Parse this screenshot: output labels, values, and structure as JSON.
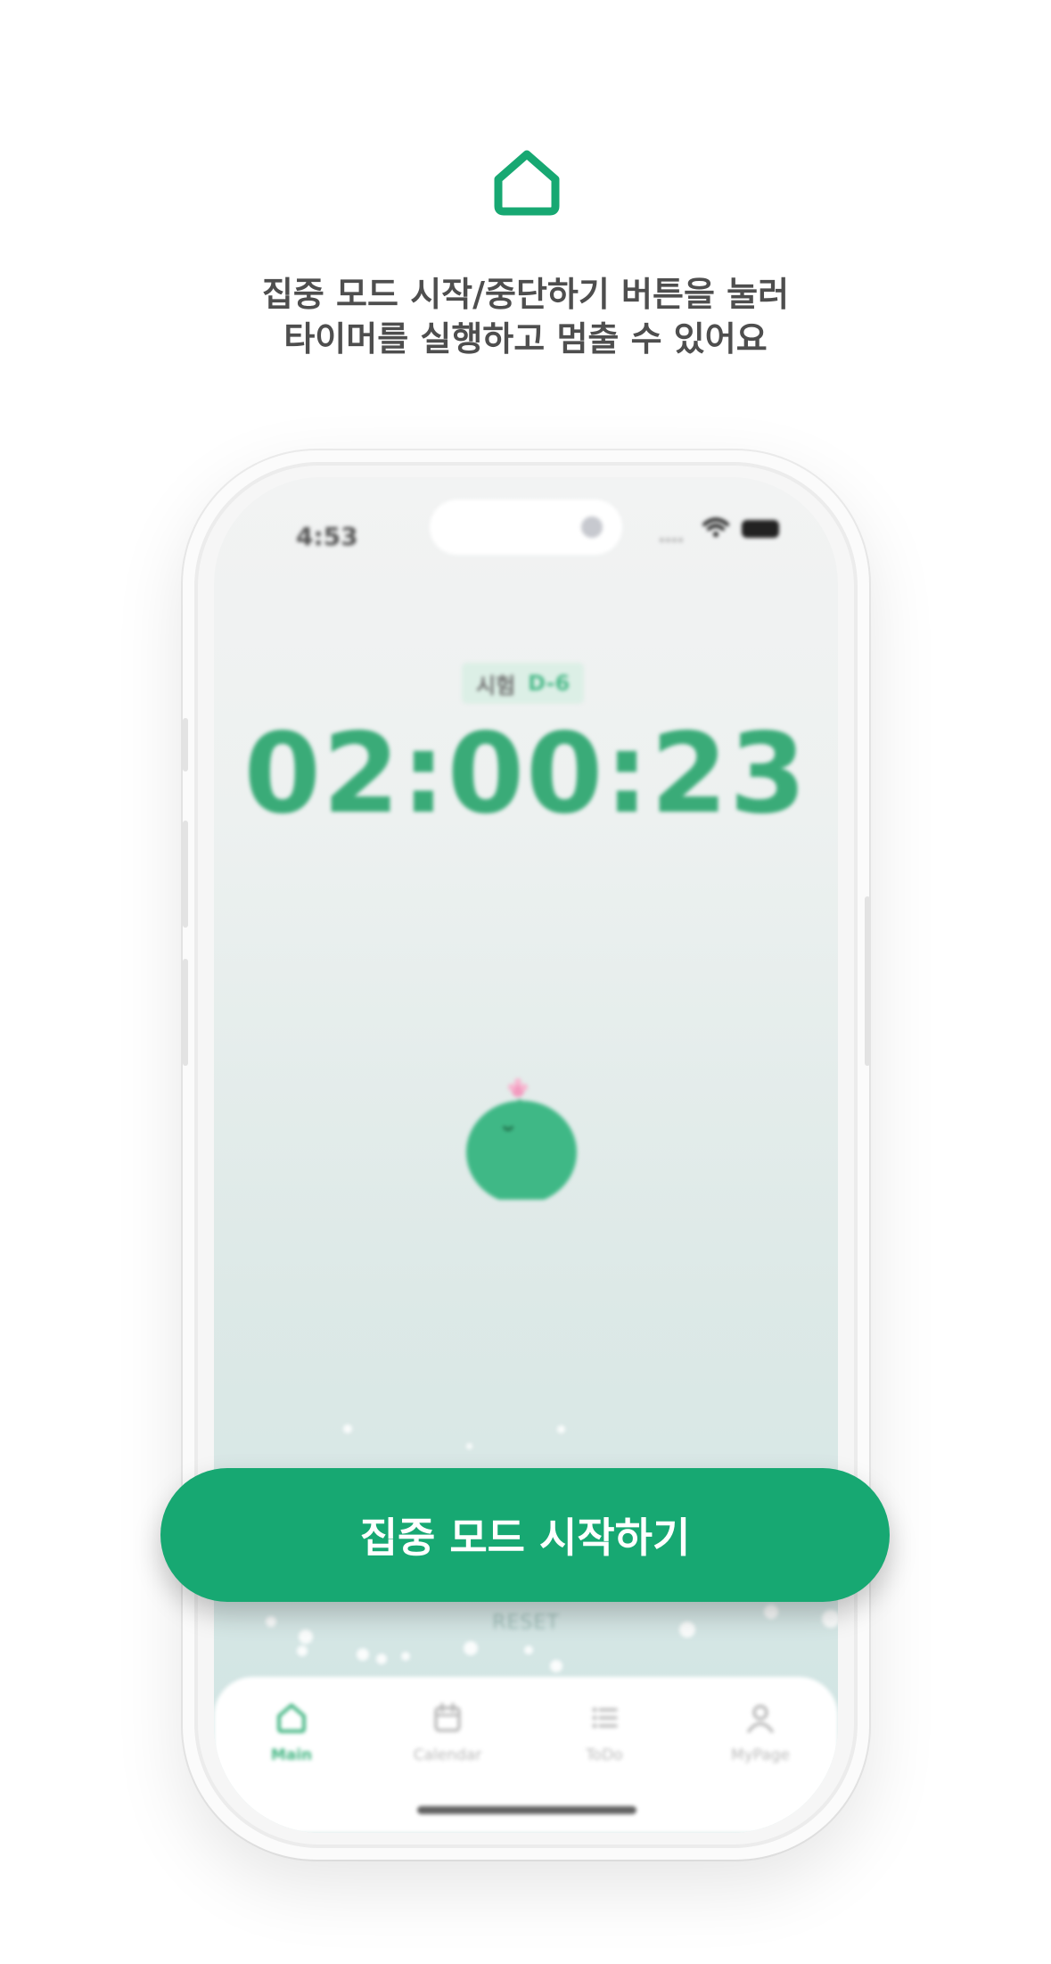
{
  "header": {
    "icon": "home-icon",
    "line1": "집중 모드 시작/중단하기 버튼을 눌러",
    "line2": "타이머를 실행하고 멈출 수 있어요"
  },
  "status_bar": {
    "time": "4:53"
  },
  "timer": {
    "badge_label": "시험",
    "badge_value": "D-6",
    "time": "02:00:23"
  },
  "reset_label": "RESET",
  "cta": {
    "label": "집중 모드 시작하기"
  },
  "tabs": [
    {
      "label": "Main",
      "icon": "home-icon",
      "active": true
    },
    {
      "label": "Calendar",
      "icon": "calendar-icon",
      "active": false
    },
    {
      "label": "ToDo",
      "icon": "list-icon",
      "active": false
    },
    {
      "label": "MyPage",
      "icon": "person-icon",
      "active": false
    }
  ],
  "colors": {
    "accent": "#17a872",
    "timer": "#3aab78",
    "character": "#3fb886",
    "sprout": "#f29bbf",
    "headline": "#4e4e4e"
  }
}
